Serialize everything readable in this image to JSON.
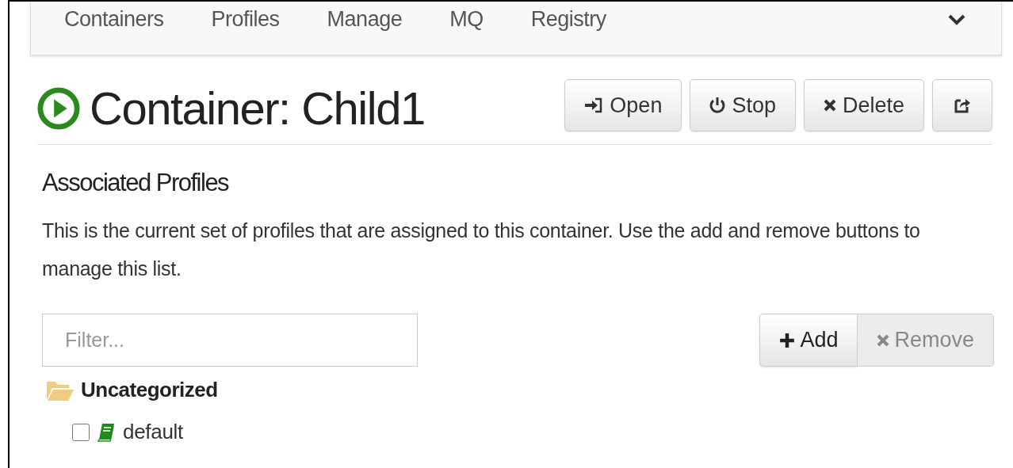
{
  "nav": {
    "items": [
      {
        "label": "Containers"
      },
      {
        "label": "Profiles"
      },
      {
        "label": "Manage"
      },
      {
        "label": "MQ"
      },
      {
        "label": "Registry"
      }
    ]
  },
  "header": {
    "title": "Container: Child1",
    "running": true,
    "actions": [
      {
        "kind": "open",
        "label": "Open"
      },
      {
        "kind": "stop",
        "label": "Stop"
      },
      {
        "kind": "delete",
        "label": "Delete"
      },
      {
        "kind": "share"
      }
    ]
  },
  "section": {
    "title": "Associated Profiles",
    "description": "This is the current set of profiles that are assigned to this container. Use the add and remove buttons to manage this list.",
    "filter": {
      "placeholder": "Filter..."
    },
    "buttons": [
      {
        "kind": "add",
        "label": "Add",
        "disabled": false
      },
      {
        "kind": "remove",
        "label": "Remove",
        "disabled": true
      }
    ],
    "tree": [
      {
        "label": "Uncategorized",
        "expanded": true,
        "children": [
          {
            "label": "default",
            "checked": false
          }
        ]
      }
    ]
  }
}
